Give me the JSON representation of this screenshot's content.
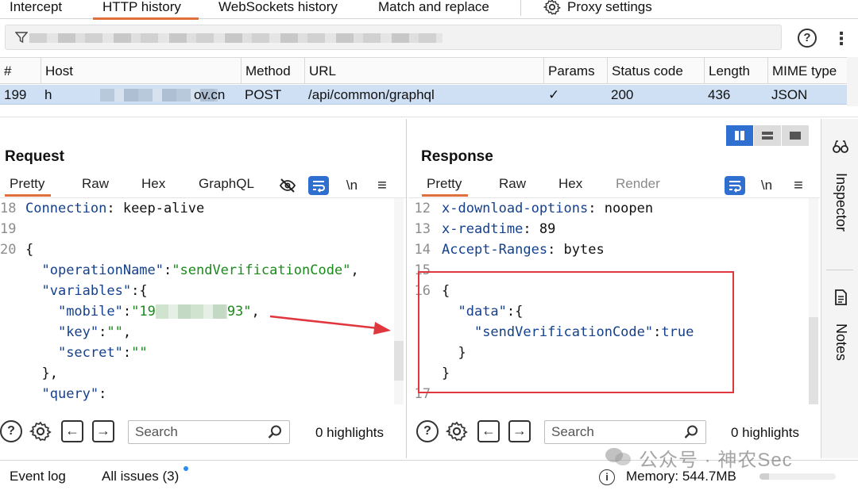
{
  "top_tabs": [
    {
      "label": "Intercept"
    },
    {
      "label": "HTTP history",
      "active": true
    },
    {
      "label": "WebSockets history"
    },
    {
      "label": "Match and replace"
    },
    {
      "label": "Proxy settings"
    }
  ],
  "filter": {
    "placeholder": "",
    "help": "?"
  },
  "table": {
    "columns": [
      "#",
      "Host",
      "Method",
      "URL",
      "Params",
      "Status code",
      "Length",
      "MIME type"
    ],
    "row": {
      "num": "199",
      "host_prefix": "h",
      "host_suffix": "ov.cn",
      "method": "POST",
      "url": "/api/common/graphql",
      "params": "✓",
      "status": "200",
      "length": "436",
      "mime": "JSON"
    }
  },
  "request": {
    "title": "Request",
    "tabs": [
      "Pretty",
      "Raw",
      "Hex",
      "GraphQL"
    ],
    "newline": "\\n",
    "lines": [
      {
        "n": "18",
        "parts": [
          [
            "k",
            "Connection"
          ],
          [
            "p",
            ": keep-alive"
          ]
        ]
      },
      {
        "n": "19",
        "parts": []
      },
      {
        "n": "20",
        "parts": [
          [
            "p",
            "{"
          ]
        ]
      },
      {
        "n": "",
        "parts": [
          [
            "p",
            "  "
          ],
          [
            "k",
            "\"operationName\""
          ],
          [
            "p",
            ":"
          ],
          [
            "s",
            "\"sendVerificationCode\""
          ],
          [
            "p",
            ","
          ]
        ]
      },
      {
        "n": "",
        "parts": [
          [
            "p",
            "  "
          ],
          [
            "k",
            "\"variables\""
          ],
          [
            "p",
            ":{"
          ]
        ]
      },
      {
        "n": "",
        "parts": [
          [
            "p",
            "    "
          ],
          [
            "k",
            "\"mobile\""
          ],
          [
            "p",
            ":"
          ],
          [
            "s",
            "\"19"
          ],
          [
            "blur",
            ""
          ],
          [
            "s",
            "93\""
          ],
          [
            "p",
            ","
          ]
        ]
      },
      {
        "n": "",
        "parts": [
          [
            "p",
            "    "
          ],
          [
            "k",
            "\"key\""
          ],
          [
            "p",
            ":"
          ],
          [
            "s",
            "\"\""
          ],
          [
            "p",
            ","
          ]
        ]
      },
      {
        "n": "",
        "parts": [
          [
            "p",
            "    "
          ],
          [
            "k",
            "\"secret\""
          ],
          [
            "p",
            ":"
          ],
          [
            "s",
            "\"\""
          ]
        ]
      },
      {
        "n": "",
        "parts": [
          [
            "p",
            "  },"
          ]
        ]
      },
      {
        "n": "",
        "parts": [
          [
            "p",
            "  "
          ],
          [
            "k",
            "\"query\""
          ],
          [
            "p",
            ":"
          ]
        ]
      }
    ],
    "search_placeholder": "Search",
    "highlights": "0 highlights"
  },
  "response": {
    "title": "Response",
    "tabs": [
      "Pretty",
      "Raw",
      "Hex",
      "Render"
    ],
    "newline": "\\n",
    "lines": [
      {
        "n": "12",
        "parts": [
          [
            "k",
            "x-download-options"
          ],
          [
            "p",
            ": noopen"
          ]
        ]
      },
      {
        "n": "13",
        "parts": [
          [
            "k",
            "x-readtime"
          ],
          [
            "p",
            ": 89"
          ]
        ]
      },
      {
        "n": "14",
        "parts": [
          [
            "k",
            "Accept-Ranges"
          ],
          [
            "p",
            ": bytes"
          ]
        ]
      },
      {
        "n": "15",
        "parts": []
      },
      {
        "n": "16",
        "parts": [
          [
            "p",
            "{"
          ]
        ]
      },
      {
        "n": "",
        "parts": [
          [
            "p",
            "  "
          ],
          [
            "k",
            "\"data\""
          ],
          [
            "p",
            ":{"
          ]
        ]
      },
      {
        "n": "",
        "parts": [
          [
            "p",
            "    "
          ],
          [
            "k",
            "\"sendVerificationCode\""
          ],
          [
            "p",
            ":"
          ],
          [
            "k",
            "true"
          ]
        ]
      },
      {
        "n": "",
        "parts": [
          [
            "p",
            "  }"
          ]
        ]
      },
      {
        "n": "",
        "parts": [
          [
            "p",
            "}"
          ]
        ]
      },
      {
        "n": "17",
        "parts": []
      }
    ],
    "search_placeholder": "Search",
    "highlights": "0 highlights"
  },
  "side": {
    "inspector": "Inspector",
    "notes": "Notes"
  },
  "status": {
    "event_log": "Event log",
    "issues": "All issues (3)",
    "memory": "Memory: 544.7MB",
    "memory_fraction": 0.12
  },
  "watermark": "公众号 · 神农Sec",
  "colors": {
    "accent": "#e06f3c",
    "selection": "#cfe0f4",
    "wrap_button": "#2f6fd0",
    "annotation": "#e0373f"
  }
}
